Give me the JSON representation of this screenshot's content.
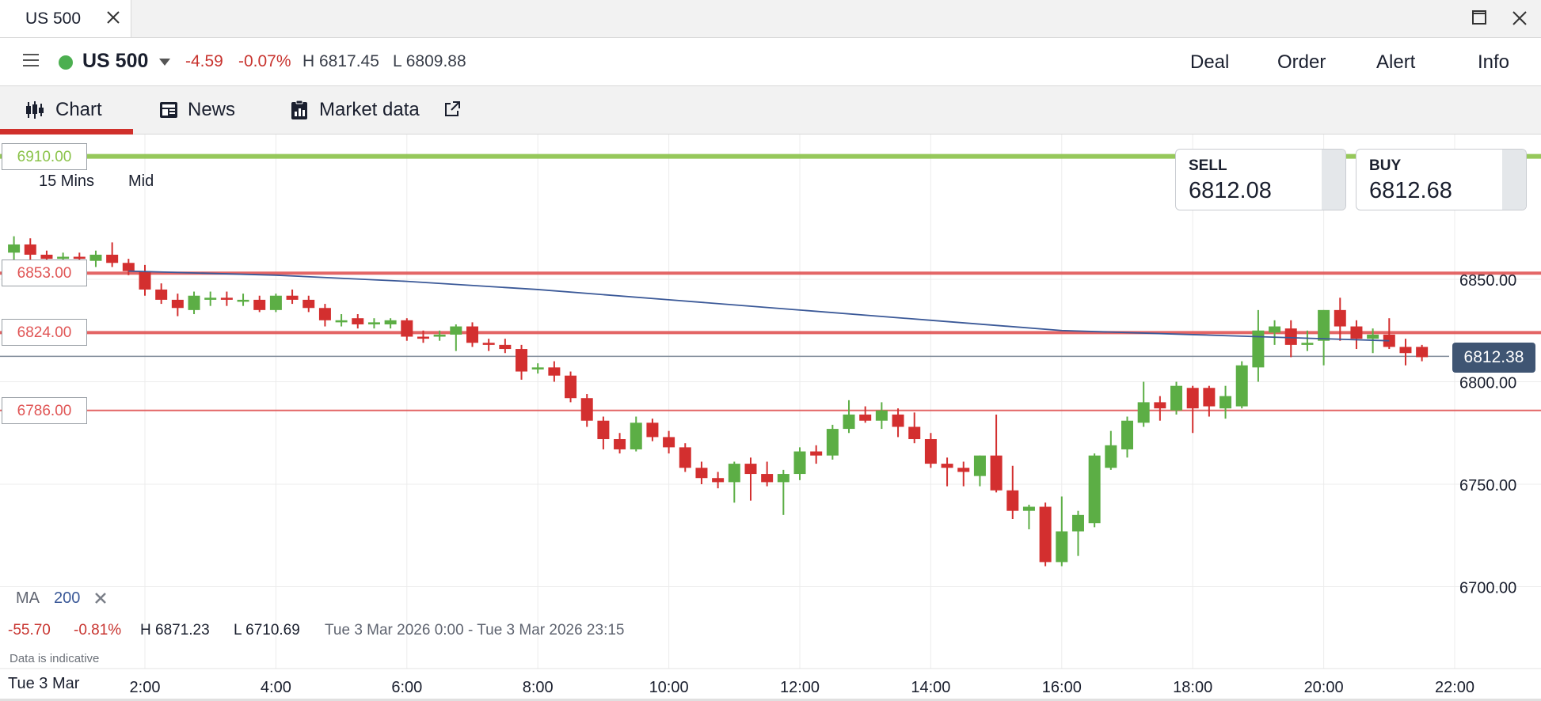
{
  "window": {
    "tab_title": "US 500"
  },
  "header": {
    "market_name": "US 500",
    "change": "-4.59",
    "change_pct": "-0.07%",
    "high": "H 6817.45",
    "low": "L 6809.88",
    "buttons": [
      "Deal",
      "Order",
      "Alert",
      "Info"
    ]
  },
  "subnav": {
    "tabs": [
      {
        "label": "Chart",
        "icon": "candlestick-icon",
        "active": true
      },
      {
        "label": "News",
        "icon": "newspaper-icon",
        "active": false
      },
      {
        "label": "Market data",
        "icon": "clipboard-chart-icon",
        "active": false
      }
    ]
  },
  "chart": {
    "timeframe": "15 Mins",
    "price_type": "Mid",
    "quote": {
      "sell_label": "SELL",
      "sell_value": "6812.08",
      "buy_label": "BUY",
      "buy_value": "6812.68"
    },
    "current_price": "6812.38",
    "levels": [
      {
        "label": "6910.00",
        "value": 6910,
        "color": "#8bc34a"
      },
      {
        "label": "6853.00",
        "value": 6853,
        "color": "#e05555"
      },
      {
        "label": "6824.00",
        "value": 6824,
        "color": "#e05555"
      },
      {
        "label": "6786.00",
        "value": 6786,
        "color": "#e05555"
      }
    ],
    "indicator": {
      "name": "MA",
      "period": "200"
    },
    "stats": {
      "change": "-55.70",
      "change_pct": "-0.81%",
      "high": "H 6871.23",
      "low": "L 6710.69",
      "range": "Tue 3 Mar 2026 0:00 - Tue 3 Mar 2026 23:15"
    },
    "disclaimer": "Data is indicative",
    "date_label": "Tue 3 Mar"
  },
  "chart_data": {
    "type": "candlestick",
    "interval": "15 Mins",
    "x_ticks": [
      "2:00",
      "4:00",
      "6:00",
      "8:00",
      "10:00",
      "12:00",
      "14:00",
      "16:00",
      "18:00",
      "20:00",
      "22:00"
    ],
    "y_ticks": [
      "6850.00",
      "6800.00",
      "6750.00",
      "6700.00"
    ],
    "ylim": [
      6690,
      6915
    ],
    "colors": {
      "up": "#5cae45",
      "down": "#d32f2f",
      "ma": "#3b5998"
    },
    "candles": [
      {
        "t": "0:00",
        "o": 6863,
        "h": 6871,
        "l": 6858,
        "c": 6867
      },
      {
        "t": "0:15",
        "o": 6867,
        "h": 6870,
        "l": 6859,
        "c": 6862
      },
      {
        "t": "0:30",
        "o": 6862,
        "h": 6864,
        "l": 6859,
        "c": 6860
      },
      {
        "t": "0:45",
        "o": 6860,
        "h": 6863,
        "l": 6858,
        "c": 6861
      },
      {
        "t": "1:00",
        "o": 6861,
        "h": 6863,
        "l": 6857,
        "c": 6860
      },
      {
        "t": "1:15",
        "o": 6859,
        "h": 6864,
        "l": 6856,
        "c": 6862
      },
      {
        "t": "1:30",
        "o": 6862,
        "h": 6868,
        "l": 6856,
        "c": 6858
      },
      {
        "t": "1:45",
        "o": 6858,
        "h": 6860,
        "l": 6852,
        "c": 6854
      },
      {
        "t": "2:00",
        "o": 6854,
        "h": 6857,
        "l": 6842,
        "c": 6845
      },
      {
        "t": "2:15",
        "o": 6845,
        "h": 6848,
        "l": 6838,
        "c": 6840
      },
      {
        "t": "2:30",
        "o": 6840,
        "h": 6843,
        "l": 6832,
        "c": 6836
      },
      {
        "t": "2:45",
        "o": 6835,
        "h": 6844,
        "l": 6833,
        "c": 6842
      },
      {
        "t": "3:00",
        "o": 6840,
        "h": 6844,
        "l": 6837,
        "c": 6841
      },
      {
        "t": "3:15",
        "o": 6841,
        "h": 6844,
        "l": 6837,
        "c": 6840
      },
      {
        "t": "3:30",
        "o": 6840,
        "h": 6843,
        "l": 6837,
        "c": 6840
      },
      {
        "t": "3:45",
        "o": 6840,
        "h": 6842,
        "l": 6834,
        "c": 6835
      },
      {
        "t": "4:00",
        "o": 6835,
        "h": 6843,
        "l": 6834,
        "c": 6842
      },
      {
        "t": "4:15",
        "o": 6842,
        "h": 6845,
        "l": 6838,
        "c": 6840
      },
      {
        "t": "4:30",
        "o": 6840,
        "h": 6842,
        "l": 6834,
        "c": 6836
      },
      {
        "t": "4:45",
        "o": 6836,
        "h": 6838,
        "l": 6827,
        "c": 6830
      },
      {
        "t": "5:00",
        "o": 6829,
        "h": 6833,
        "l": 6827,
        "c": 6830
      },
      {
        "t": "5:15",
        "o": 6831,
        "h": 6833,
        "l": 6826,
        "c": 6828
      },
      {
        "t": "5:30",
        "o": 6828,
        "h": 6831,
        "l": 6826,
        "c": 6829
      },
      {
        "t": "5:45",
        "o": 6828,
        "h": 6831,
        "l": 6826,
        "c": 6830
      },
      {
        "t": "6:00",
        "o": 6830,
        "h": 6831,
        "l": 6820,
        "c": 6822
      },
      {
        "t": "6:15",
        "o": 6822,
        "h": 6825,
        "l": 6819,
        "c": 6821
      },
      {
        "t": "6:30",
        "o": 6822,
        "h": 6825,
        "l": 6820,
        "c": 6823
      },
      {
        "t": "6:45",
        "o": 6823,
        "h": 6828,
        "l": 6815,
        "c": 6827
      },
      {
        "t": "7:00",
        "o": 6827,
        "h": 6829,
        "l": 6817,
        "c": 6819
      },
      {
        "t": "7:15",
        "o": 6819,
        "h": 6821,
        "l": 6815,
        "c": 6818
      },
      {
        "t": "7:30",
        "o": 6818,
        "h": 6821,
        "l": 6814,
        "c": 6816
      },
      {
        "t": "7:45",
        "o": 6816,
        "h": 6818,
        "l": 6801,
        "c": 6805
      },
      {
        "t": "8:00",
        "o": 6806,
        "h": 6809,
        "l": 6804,
        "c": 6807
      },
      {
        "t": "8:15",
        "o": 6807,
        "h": 6810,
        "l": 6800,
        "c": 6803
      },
      {
        "t": "8:30",
        "o": 6803,
        "h": 6805,
        "l": 6790,
        "c": 6792
      },
      {
        "t": "8:45",
        "o": 6792,
        "h": 6794,
        "l": 6778,
        "c": 6781
      },
      {
        "t": "9:00",
        "o": 6781,
        "h": 6783,
        "l": 6767,
        "c": 6772
      },
      {
        "t": "9:15",
        "o": 6772,
        "h": 6775,
        "l": 6765,
        "c": 6767
      },
      {
        "t": "9:30",
        "o": 6767,
        "h": 6783,
        "l": 6766,
        "c": 6780
      },
      {
        "t": "9:45",
        "o": 6780,
        "h": 6782,
        "l": 6771,
        "c": 6773
      },
      {
        "t": "10:00",
        "o": 6773,
        "h": 6776,
        "l": 6765,
        "c": 6768
      },
      {
        "t": "10:15",
        "o": 6768,
        "h": 6770,
        "l": 6756,
        "c": 6758
      },
      {
        "t": "10:30",
        "o": 6758,
        "h": 6761,
        "l": 6750,
        "c": 6753
      },
      {
        "t": "10:45",
        "o": 6753,
        "h": 6756,
        "l": 6748,
        "c": 6751
      },
      {
        "t": "11:00",
        "o": 6751,
        "h": 6761,
        "l": 6741,
        "c": 6760
      },
      {
        "t": "11:15",
        "o": 6760,
        "h": 6763,
        "l": 6742,
        "c": 6755
      },
      {
        "t": "11:30",
        "o": 6755,
        "h": 6761,
        "l": 6749,
        "c": 6751
      },
      {
        "t": "11:45",
        "o": 6751,
        "h": 6757,
        "l": 6735,
        "c": 6755
      },
      {
        "t": "12:00",
        "o": 6755,
        "h": 6768,
        "l": 6752,
        "c": 6766
      },
      {
        "t": "12:15",
        "o": 6766,
        "h": 6769,
        "l": 6760,
        "c": 6764
      },
      {
        "t": "12:30",
        "o": 6764,
        "h": 6779,
        "l": 6762,
        "c": 6777
      },
      {
        "t": "12:45",
        "o": 6777,
        "h": 6791,
        "l": 6775,
        "c": 6784
      },
      {
        "t": "13:00",
        "o": 6784,
        "h": 6788,
        "l": 6780,
        "c": 6781
      },
      {
        "t": "13:15",
        "o": 6781,
        "h": 6790,
        "l": 6777,
        "c": 6786
      },
      {
        "t": "13:30",
        "o": 6784,
        "h": 6787,
        "l": 6773,
        "c": 6778
      },
      {
        "t": "13:45",
        "o": 6778,
        "h": 6785,
        "l": 6770,
        "c": 6772
      },
      {
        "t": "14:00",
        "o": 6772,
        "h": 6775,
        "l": 6758,
        "c": 6760
      },
      {
        "t": "14:15",
        "o": 6760,
        "h": 6763,
        "l": 6749,
        "c": 6758
      },
      {
        "t": "14:30",
        "o": 6758,
        "h": 6761,
        "l": 6749,
        "c": 6756
      },
      {
        "t": "14:45",
        "o": 6754,
        "h": 6764,
        "l": 6749,
        "c": 6764
      },
      {
        "t": "15:00",
        "o": 6764,
        "h": 6784,
        "l": 6746,
        "c": 6747
      },
      {
        "t": "15:15",
        "o": 6747,
        "h": 6759,
        "l": 6733,
        "c": 6737
      },
      {
        "t": "15:30",
        "o": 6737,
        "h": 6740,
        "l": 6728,
        "c": 6739
      },
      {
        "t": "15:45",
        "o": 6739,
        "h": 6741,
        "l": 6710,
        "c": 6712
      },
      {
        "t": "16:00",
        "o": 6712,
        "h": 6744,
        "l": 6710,
        "c": 6727
      },
      {
        "t": "16:15",
        "o": 6727,
        "h": 6737,
        "l": 6715,
        "c": 6735
      },
      {
        "t": "16:30",
        "o": 6731,
        "h": 6765,
        "l": 6729,
        "c": 6764
      },
      {
        "t": "16:45",
        "o": 6758,
        "h": 6776,
        "l": 6757,
        "c": 6769
      },
      {
        "t": "17:00",
        "o": 6767,
        "h": 6783,
        "l": 6763,
        "c": 6781
      },
      {
        "t": "17:15",
        "o": 6780,
        "h": 6800,
        "l": 6778,
        "c": 6790
      },
      {
        "t": "17:30",
        "o": 6790,
        "h": 6793,
        "l": 6781,
        "c": 6787
      },
      {
        "t": "17:45",
        "o": 6786,
        "h": 6800,
        "l": 6784,
        "c": 6798
      },
      {
        "t": "18:00",
        "o": 6797,
        "h": 6798,
        "l": 6775,
        "c": 6787
      },
      {
        "t": "18:15",
        "o": 6797,
        "h": 6798,
        "l": 6783,
        "c": 6788
      },
      {
        "t": "18:30",
        "o": 6787,
        "h": 6798,
        "l": 6782,
        "c": 6793
      },
      {
        "t": "18:45",
        "o": 6788,
        "h": 6810,
        "l": 6787,
        "c": 6808
      },
      {
        "t": "19:00",
        "o": 6807,
        "h": 6835,
        "l": 6800,
        "c": 6825
      },
      {
        "t": "19:15",
        "o": 6824,
        "h": 6830,
        "l": 6818,
        "c": 6827
      },
      {
        "t": "19:30",
        "o": 6826,
        "h": 6830,
        "l": 6812,
        "c": 6818
      },
      {
        "t": "19:45",
        "o": 6818,
        "h": 6825,
        "l": 6815,
        "c": 6819
      },
      {
        "t": "20:00",
        "o": 6820,
        "h": 6835,
        "l": 6808,
        "c": 6835
      },
      {
        "t": "20:15",
        "o": 6835,
        "h": 6841,
        "l": 6820,
        "c": 6827
      },
      {
        "t": "20:30",
        "o": 6827,
        "h": 6830,
        "l": 6816,
        "c": 6821
      },
      {
        "t": "20:45",
        "o": 6821,
        "h": 6826,
        "l": 6814,
        "c": 6823
      },
      {
        "t": "21:00",
        "o": 6823,
        "h": 6831,
        "l": 6816,
        "c": 6817
      },
      {
        "t": "21:15",
        "o": 6817,
        "h": 6821,
        "l": 6808,
        "c": 6814
      },
      {
        "t": "21:30",
        "o": 6817,
        "h": 6818,
        "l": 6810,
        "c": 6812
      }
    ],
    "ma200": [
      {
        "t": "1:45",
        "v": 6854
      },
      {
        "t": "4:00",
        "v": 6852
      },
      {
        "t": "6:00",
        "v": 6849
      },
      {
        "t": "8:00",
        "v": 6845
      },
      {
        "t": "10:00",
        "v": 6840
      },
      {
        "t": "12:00",
        "v": 6835
      },
      {
        "t": "14:00",
        "v": 6830
      },
      {
        "t": "16:00",
        "v": 6825
      },
      {
        "t": "18:00",
        "v": 6823
      },
      {
        "t": "20:00",
        "v": 6821
      },
      {
        "t": "21:00",
        "v": 6820
      }
    ]
  }
}
